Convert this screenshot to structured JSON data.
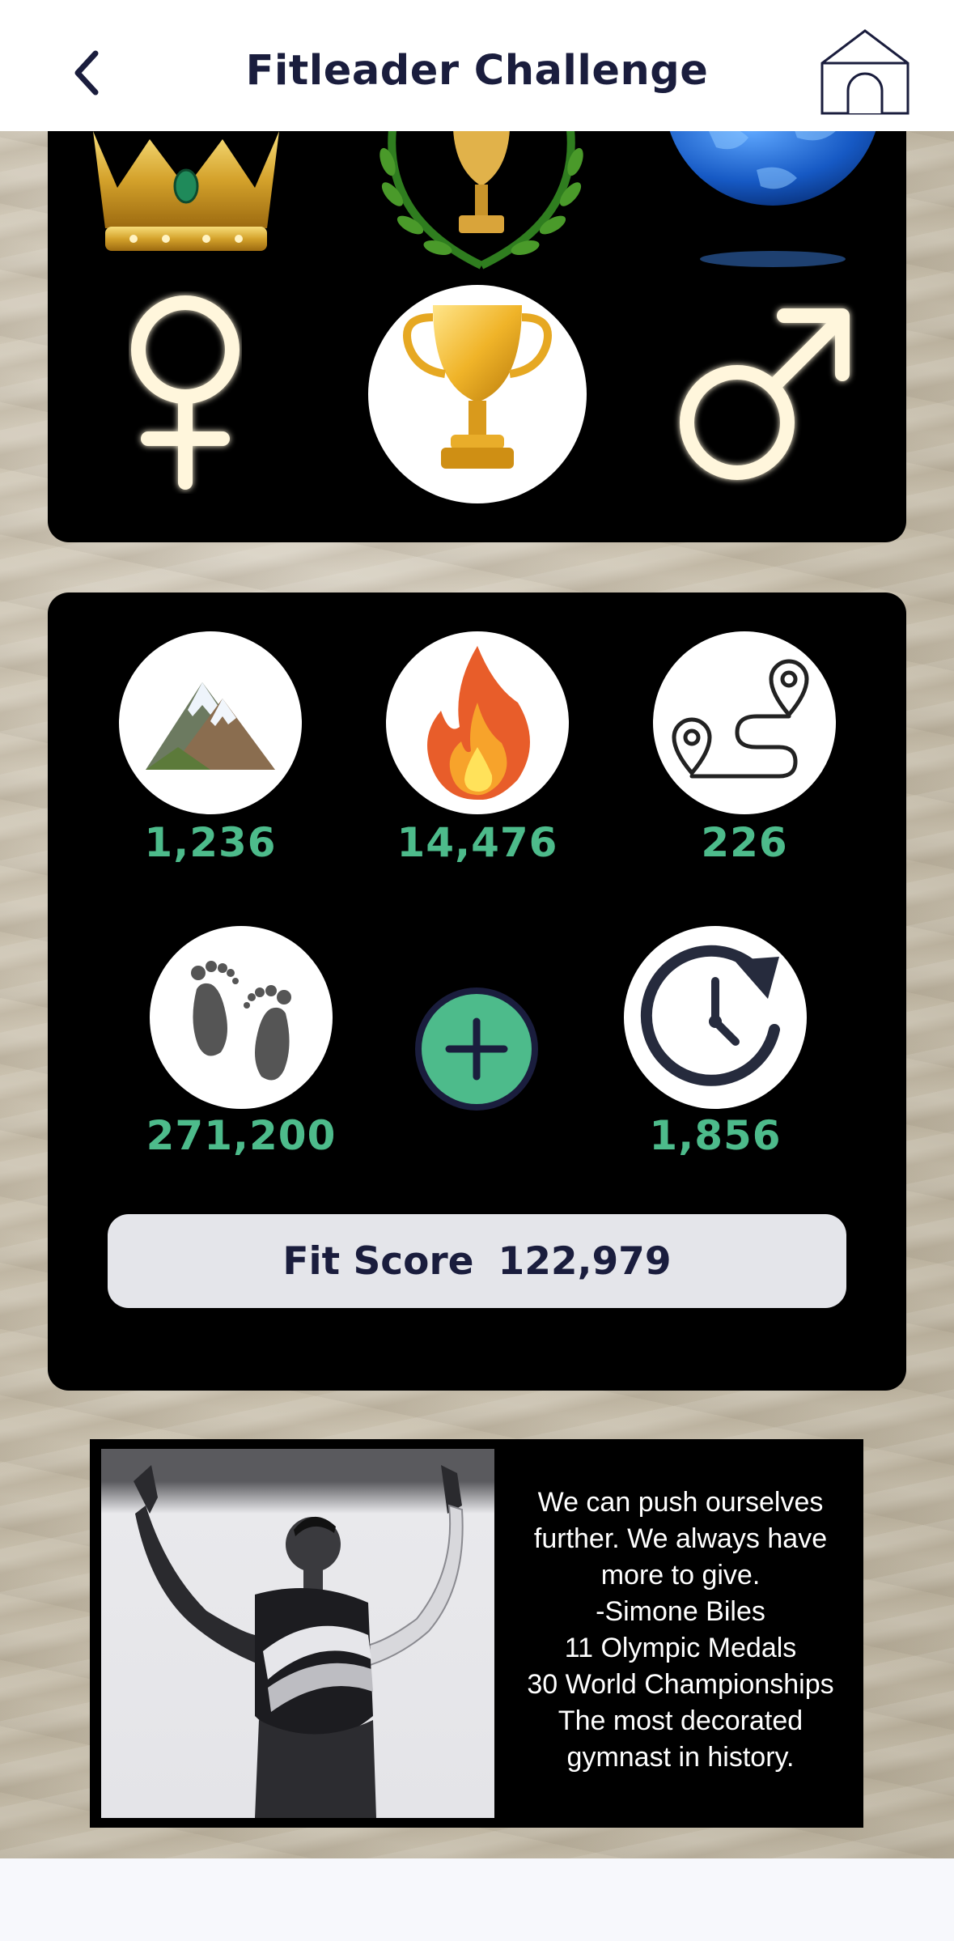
{
  "header": {
    "title": "Fitleader Challenge"
  },
  "stats": {
    "elevation": "1,236",
    "calories": "14,476",
    "distance": "226",
    "steps": "271,200",
    "minutes": "1,856"
  },
  "fit_score": {
    "label": "Fit Score",
    "value": "122,979"
  },
  "quote": {
    "lines": [
      "We can push ourselves",
      "further. We always have",
      "more to give.",
      "-Simone Biles",
      "11 Olympic Medals",
      "30 World Championships",
      "The most decorated",
      "gymnast in history."
    ]
  },
  "colors": {
    "accent_green": "#4dbb8b",
    "navy": "#1a1d3d",
    "panel": "#000000"
  }
}
